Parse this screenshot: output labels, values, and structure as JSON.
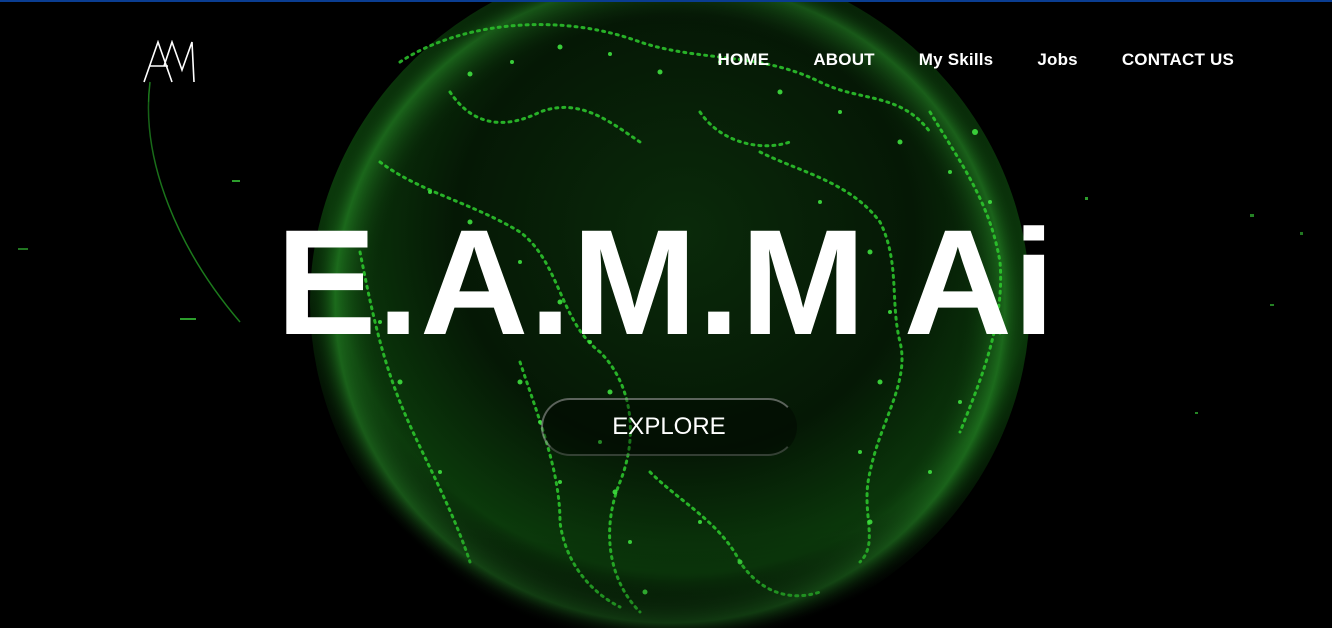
{
  "logo": {
    "icon": "am-monogram-logo"
  },
  "nav": {
    "items": [
      {
        "label": "HOME"
      },
      {
        "label": "ABOUT"
      },
      {
        "label": "My Skills"
      },
      {
        "label": "Jobs"
      },
      {
        "label": "CONTACT US"
      }
    ]
  },
  "hero": {
    "title": "E.A.M.M Ai",
    "cta_label": "EXPLORE",
    "background": "digital-globe-image"
  },
  "colors": {
    "background": "#000000",
    "accent": "#2bd42b",
    "text": "#ffffff",
    "top_border": "#0a3d91"
  }
}
